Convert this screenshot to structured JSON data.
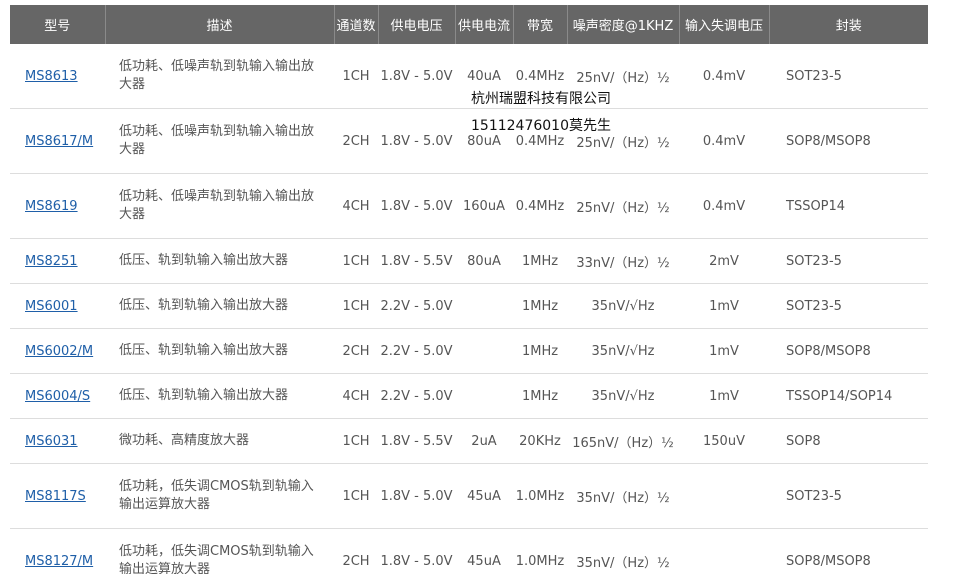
{
  "table": {
    "headers": [
      "型号",
      "描述",
      "通道数",
      "供电电压",
      "供电电流",
      "带宽",
      "噪声密度@1KHZ",
      "输入失调电压",
      "封装"
    ],
    "rows": [
      {
        "model": "MS8613",
        "desc": "低功耗、低噪声轨到轨输入输出放大器",
        "channels": "1CH",
        "voltage": "1.8V - 5.0V",
        "current": "40uA",
        "bandwidth": "0.4MHz",
        "noise": "25nV/（Hz）½",
        "offset": "0.4mV",
        "package": "SOT23-5"
      },
      {
        "model": "MS8617/M",
        "desc": "低功耗、低噪声轨到轨输入输出放大器",
        "channels": "2CH",
        "voltage": "1.8V - 5.0V",
        "current": "80uA",
        "bandwidth": "0.4MHz",
        "noise": "25nV/（Hz）½",
        "offset": "0.4mV",
        "package": "SOP8/MSOP8"
      },
      {
        "model": "MS8619",
        "desc": "低功耗、低噪声轨到轨输入输出放大器",
        "channels": "4CH",
        "voltage": "1.8V - 5.0V",
        "current": "160uA",
        "bandwidth": "0.4MHz",
        "noise": "25nV/（Hz）½",
        "offset": "0.4mV",
        "package": "TSSOP14"
      },
      {
        "model": "MS8251",
        "desc": "低压、轨到轨输入输出放大器",
        "channels": "1CH",
        "voltage": "1.8V - 5.5V",
        "current": "80uA",
        "bandwidth": "1MHz",
        "noise": "33nV/（Hz）½",
        "offset": "2mV",
        "package": "SOT23-5"
      },
      {
        "model": "MS6001",
        "desc": "低压、轨到轨输入输出放大器",
        "channels": "1CH",
        "voltage": "2.2V - 5.0V",
        "current": "",
        "bandwidth": "1MHz",
        "noise": "35nV/√Hz",
        "offset": "1mV",
        "package": "SOT23-5"
      },
      {
        "model": "MS6002/M",
        "desc": "低压、轨到轨输入输出放大器",
        "channels": "2CH",
        "voltage": "2.2V - 5.0V",
        "current": "",
        "bandwidth": "1MHz",
        "noise": "35nV/√Hz",
        "offset": "1mV",
        "package": "SOP8/MSOP8"
      },
      {
        "model": "MS6004/S",
        "desc": "低压、轨到轨输入输出放大器",
        "channels": "4CH",
        "voltage": "2.2V - 5.0V",
        "current": "",
        "bandwidth": "1MHz",
        "noise": "35nV/√Hz",
        "offset": "1mV",
        "package": "TSSOP14/SOP14"
      },
      {
        "model": "MS6031",
        "desc": "微功耗、高精度放大器",
        "channels": "1CH",
        "voltage": "1.8V - 5.5V",
        "current": "2uA",
        "bandwidth": "20KHz",
        "noise": "165nV/（Hz）½",
        "offset": "150uV",
        "package": "SOP8"
      },
      {
        "model": "MS8117S",
        "desc": "低功耗，低失调CMOS轨到轨输入输出运算放大器",
        "channels": "1CH",
        "voltage": "1.8V - 5.0V",
        "current": "45uA",
        "bandwidth": "1.0MHz",
        "noise": "35nV/（Hz）½",
        "offset": "",
        "package": "SOT23-5"
      },
      {
        "model": "MS8127/M",
        "desc": "低功耗，低失调CMOS轨到轨输入输出运算放大器",
        "channels": "2CH",
        "voltage": "1.8V - 5.0V",
        "current": "45uA",
        "bandwidth": "1.0MHz",
        "noise": "35nV/（Hz）½",
        "offset": "",
        "package": "SOP8/MSOP8"
      }
    ]
  },
  "overlay": {
    "company": "杭州瑞盟科技有限公司",
    "contact": "15112476010莫先生"
  },
  "colors": {
    "header_bg": "#666666",
    "link": "#1f5fa8"
  }
}
